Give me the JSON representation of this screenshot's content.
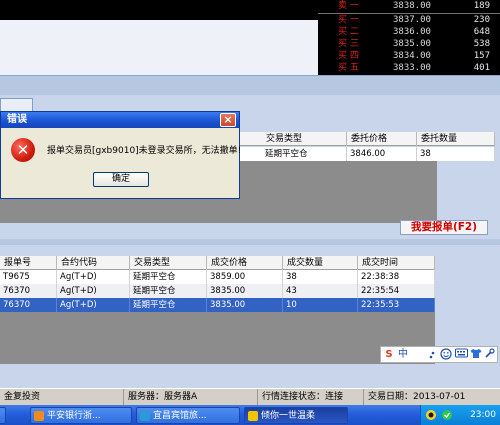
{
  "order_book": {
    "rows": [
      {
        "label": "卖一",
        "price": "3838.00",
        "qty": "189"
      },
      {
        "label": "买一",
        "price": "3837.00",
        "qty": "230"
      },
      {
        "label": "买二",
        "price": "3836.00",
        "qty": "648"
      },
      {
        "label": "买三",
        "price": "3835.00",
        "qty": "538"
      },
      {
        "label": "买四",
        "price": "3834.00",
        "qty": "157"
      },
      {
        "label": "买五",
        "price": "3833.00",
        "qty": "401"
      }
    ]
  },
  "entrust_table": {
    "headers": [
      "交易类型",
      "委托价格",
      "委托数量"
    ],
    "row": {
      "trade_type": "延期平空仓",
      "price": "3846.00",
      "qty": "38"
    }
  },
  "report_button": {
    "label": "我要报单(F2)"
  },
  "deal_table": {
    "headers": [
      "报单号",
      "合约代码",
      "交易类型",
      "成交价格",
      "成交数量",
      "成交时间"
    ],
    "rows": [
      {
        "order": "T9675",
        "contract": "Ag(T+D)",
        "type": "延期平空仓",
        "price": "3859.00",
        "qty": "38",
        "time": "22:38:38"
      },
      {
        "order": "76370",
        "contract": "Ag(T+D)",
        "type": "延期平空仓",
        "price": "3835.00",
        "qty": "43",
        "time": "22:35:54"
      },
      {
        "order": "76370",
        "contract": "Ag(T+D)",
        "type": "延期平空仓",
        "price": "3835.00",
        "qty": "10",
        "time": "22:35:53"
      }
    ]
  },
  "error_dialog": {
    "title": "错误",
    "close": "×",
    "message": "报单交易员[gxb9010]未登录交易所，无法撤单!",
    "ok_label": "确定"
  },
  "status_bar": {
    "company": "金复投资",
    "server": "服务器：服务器A",
    "connection": "行情连接状态：连接",
    "trade_date": "交易日期：2013-07-01"
  },
  "ime": {
    "s": "S",
    "zh": "中"
  },
  "taskbar": {
    "tasks": [
      {
        "label": "平安银行浙...",
        "color": "#f08a1c"
      },
      {
        "label": "宜昌宾馆旅...",
        "color": "#2a9ad8"
      },
      {
        "label": "倾你一世温柔",
        "color": "#f5c400"
      }
    ],
    "clock": "23:00"
  }
}
